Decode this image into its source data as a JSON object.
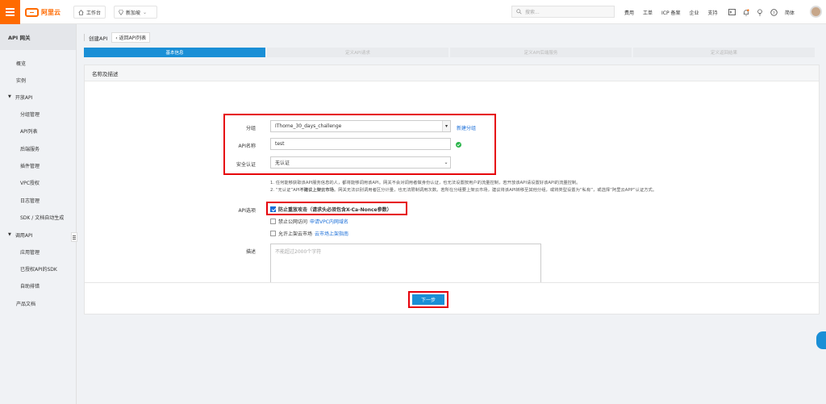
{
  "header": {
    "logo_text": "阿里云",
    "workbench": "工作台",
    "region": "新加坡",
    "search_placeholder": "搜索...",
    "links": [
      "费用",
      "工单",
      "ICP 备案",
      "企业",
      "支持"
    ],
    "language": "简体"
  },
  "sidebar": {
    "title": "API 网关",
    "items": [
      {
        "label": "概览"
      },
      {
        "label": "实例"
      },
      {
        "label": "开放API",
        "group": true
      },
      {
        "label": "分组管理"
      },
      {
        "label": "API列表"
      },
      {
        "label": "后端服务"
      },
      {
        "label": "插件管理"
      },
      {
        "label": "VPC授权"
      },
      {
        "label": "日志管理"
      },
      {
        "label": "SDK / 文档自动生成"
      },
      {
        "label": "调用API",
        "group": true
      },
      {
        "label": "应用管理"
      },
      {
        "label": "已授权API的SDK"
      },
      {
        "label": "自助排错"
      },
      {
        "label": "产品文档"
      }
    ]
  },
  "breadcrumb": {
    "title": "创建API",
    "back_label": "返回API列表"
  },
  "steps": [
    "基本信息",
    "定义API请求",
    "定义API后端服务",
    "定义返回结果"
  ],
  "form": {
    "section_title": "名称及描述",
    "group_label": "分组",
    "group_value": "IThome_30_days_challenge",
    "new_group_link": "新建分组",
    "name_label": "API名称",
    "name_value": "test",
    "auth_label": "安全认证",
    "auth_value": "无认证",
    "notes": [
      "1. 任何能够获取该API服务信息的人，都将能够调用该API。网关不会对调用者做身份认证，也无法设置按用户的流量控制，若开放该API请设置好该API的流量控制。",
      "2. “无认证”API",
      "不建议上架云市场",
      "。网关无法识别调用者区分计量，也无法限制调用次数。若所在分组要上架云市场，建议将该API转移至其他分组，或将类型设置为“私有”，或选择“阿里云APP”认证方式。"
    ],
    "options_label": "API选项",
    "option_replay": "防止重放攻击（请求头必须包含X-Ca-Nonce参数）",
    "option_internet": "禁止公网访问",
    "option_internet_link": "申请VPC内网域名",
    "option_market": "允许上架云市场",
    "option_market_link": "云市场上架指南",
    "desc_label": "描述",
    "desc_placeholder": "不能超过2000个字符"
  },
  "footer": {
    "next_label": "下一步"
  },
  "colors": {
    "brand": "#ff6a00",
    "accent": "#1a8fd6",
    "highlight": "#e6000a"
  }
}
